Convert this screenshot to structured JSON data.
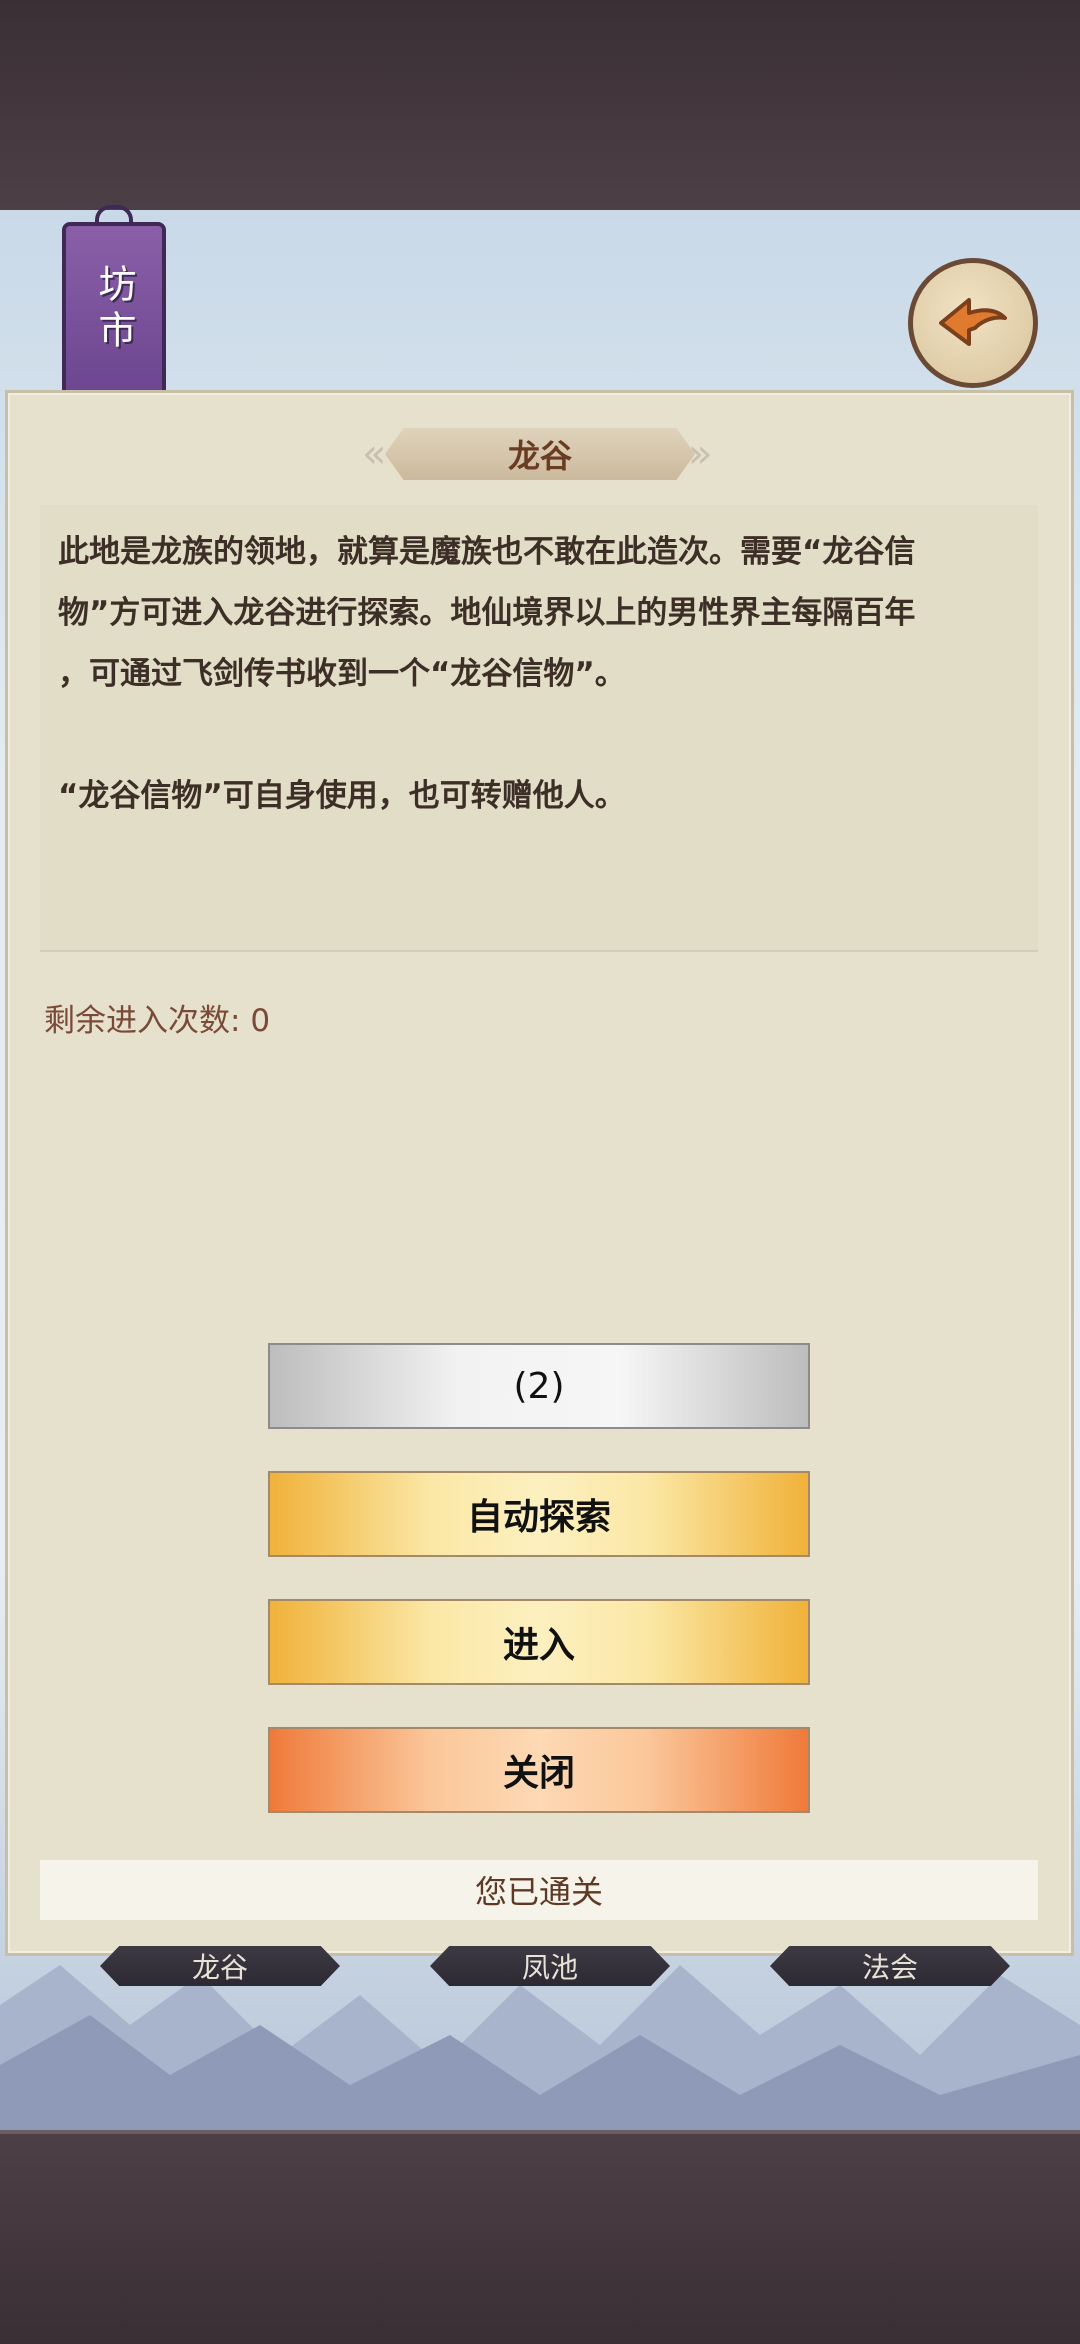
{
  "header": {
    "sign_text": "坊市",
    "back_icon": "back-arrow-icon"
  },
  "dialog": {
    "title": "龙谷",
    "description": "此地是龙族的领地，就算是魔族也不敢在此造次。需要“龙谷信\n物”方可进入龙谷进行探索。地仙境界以上的男性界主每隔百年\n，可通过飞剑传书收到一个“龙谷信物”。\n\n“龙谷信物”可自身使用，也可转赠他人。",
    "remaining_entries_label": "剩余进入次数:",
    "remaining_entries_value": "0",
    "buttons": {
      "count_label": "(2)",
      "auto_explore": "自动探索",
      "enter": "进入",
      "close": "关闭"
    },
    "status": "您已通关"
  },
  "tabs": [
    {
      "label": "龙谷"
    },
    {
      "label": "凤池"
    },
    {
      "label": "法会"
    }
  ],
  "colors": {
    "panel_bg": "#e6e1cc",
    "button_yellow": "#f0b23a",
    "button_orange": "#ef7a3a",
    "title_text": "#6a3c22"
  }
}
